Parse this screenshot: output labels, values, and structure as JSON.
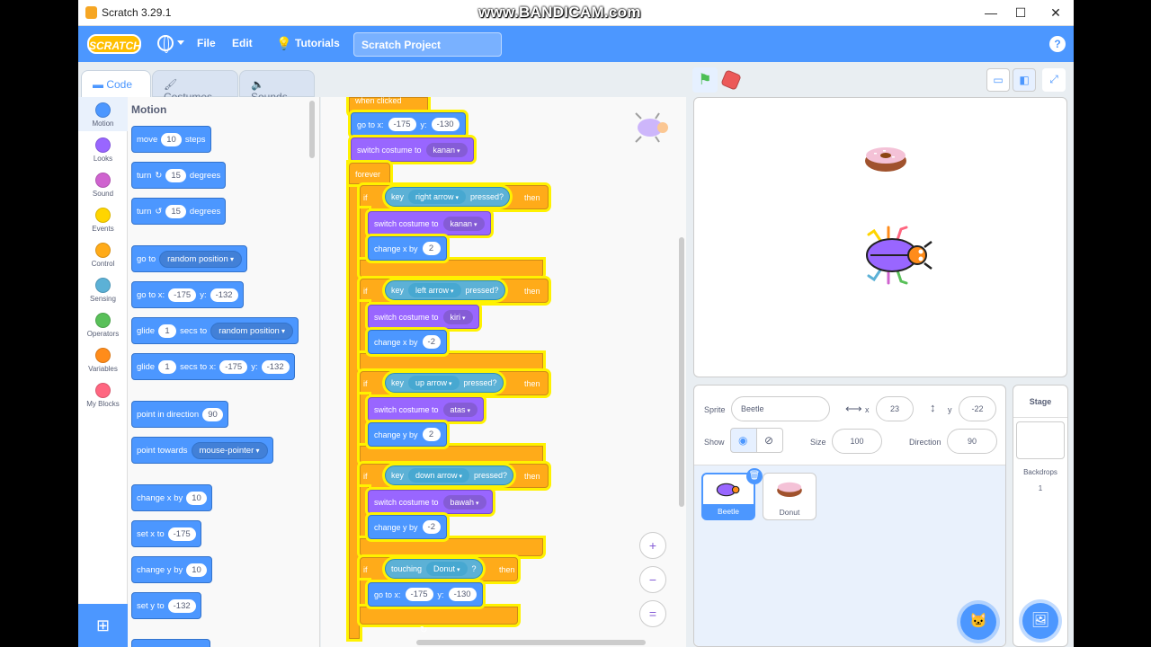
{
  "window": {
    "title": "Scratch 3.29.1",
    "watermark": "www.BANDICAM.com"
  },
  "menubar": {
    "logo": "SCRATCH",
    "file": "File",
    "edit": "Edit",
    "tutorials": "Tutorials",
    "project_title": "Scratch Project"
  },
  "tabs": {
    "code": "Code",
    "costumes": "Costumes",
    "sounds": "Sounds"
  },
  "categories": [
    {
      "label": "Motion",
      "color": "#4c97ff"
    },
    {
      "label": "Looks",
      "color": "#9966ff"
    },
    {
      "label": "Sound",
      "color": "#cf63cf"
    },
    {
      "label": "Events",
      "color": "#ffd500"
    },
    {
      "label": "Control",
      "color": "#ffab19"
    },
    {
      "label": "Sensing",
      "color": "#5cb1d6"
    },
    {
      "label": "Operators",
      "color": "#59c059"
    },
    {
      "label": "Variables",
      "color": "#ff8c1a"
    },
    {
      "label": "My Blocks",
      "color": "#ff6680"
    }
  ],
  "palette": {
    "title": "Motion",
    "move": {
      "a": "move",
      "v": "10",
      "b": "steps"
    },
    "turn_right": {
      "a": "turn",
      "v": "15",
      "b": "degrees"
    },
    "turn_left": {
      "a": "turn",
      "v": "15",
      "b": "degrees"
    },
    "goto_random": {
      "a": "go to",
      "dd": "random position"
    },
    "goto_xy": {
      "a": "go to x:",
      "x": "-175",
      "ylbl": "y:",
      "y": "-132"
    },
    "glide_random": {
      "a": "glide",
      "v": "1",
      "b": "secs to",
      "dd": "random position"
    },
    "glide_xy": {
      "a": "glide",
      "v": "1",
      "b": "secs to x:",
      "x": "-175",
      "ylbl": "y:",
      "y": "-132"
    },
    "point_dir": {
      "a": "point in direction",
      "v": "90"
    },
    "point_towards": {
      "a": "point towards",
      "dd": "mouse-pointer"
    },
    "change_x": {
      "a": "change x by",
      "v": "10"
    },
    "set_x": {
      "a": "set x to",
      "v": "-175"
    },
    "change_y": {
      "a": "change y by",
      "v": "10"
    },
    "set_y": {
      "a": "set y to",
      "v": "-132"
    }
  },
  "script": {
    "hat": "when clicked",
    "goto": {
      "a": "go to x:",
      "x": "-175",
      "ylbl": "y:",
      "y": "-130"
    },
    "switch0": {
      "a": "switch costume to",
      "dd": "kanan"
    },
    "forever": "forever",
    "if_blocks": [
      {
        "if": "if",
        "key": "key",
        "keydd": "right arrow",
        "pressed": "pressed?",
        "then": "then",
        "costume": "kanan",
        "change": "change x by",
        "val": "2"
      },
      {
        "if": "if",
        "key": "key",
        "keydd": "left arrow",
        "pressed": "pressed?",
        "then": "then",
        "costume": "kiri",
        "change": "change x by",
        "val": "-2"
      },
      {
        "if": "if",
        "key": "key",
        "keydd": "up arrow",
        "pressed": "pressed?",
        "then": "then",
        "costume": "atas",
        "change": "change y by",
        "val": "2"
      },
      {
        "if": "if",
        "key": "key",
        "keydd": "down arrow",
        "pressed": "pressed?",
        "then": "then",
        "costume": "bawah",
        "change": "change y by",
        "val": "-2"
      }
    ],
    "switch_label": "switch costume to",
    "touching": {
      "if": "if",
      "a": "touching",
      "dd": "Donut",
      "q": "?",
      "then": "then",
      "goto": "go to x:",
      "x": "-175",
      "ylbl": "y:",
      "y": "-130"
    }
  },
  "zoom": {
    "in": "+",
    "out": "−",
    "reset": "="
  },
  "sprite_info": {
    "sprite_label": "Sprite",
    "sprite_name": "Beetle",
    "x_label": "x",
    "x": "23",
    "y_label": "y",
    "y": "-22",
    "show_label": "Show",
    "size_label": "Size",
    "size": "100",
    "direction_label": "Direction",
    "direction": "90"
  },
  "sprites": [
    {
      "name": "Beetle"
    },
    {
      "name": "Donut"
    }
  ],
  "stage_pane": {
    "title": "Stage",
    "backdrops_label": "Backdrops",
    "backdrops_count": "1"
  }
}
